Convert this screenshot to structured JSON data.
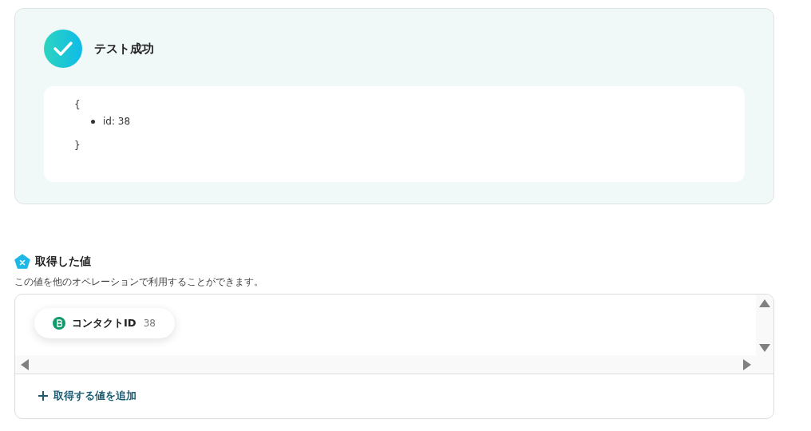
{
  "test_result": {
    "title": "テスト成功",
    "output": {
      "open": "{",
      "items": [
        "id: 38"
      ],
      "close": "}"
    }
  },
  "captured_values": {
    "title": "取得した値",
    "description": "この値を他のオペレーションで利用することができます。",
    "chips": [
      {
        "label": "コンタクトID",
        "value": "38"
      }
    ],
    "add_button": "取得する値を追加"
  }
}
